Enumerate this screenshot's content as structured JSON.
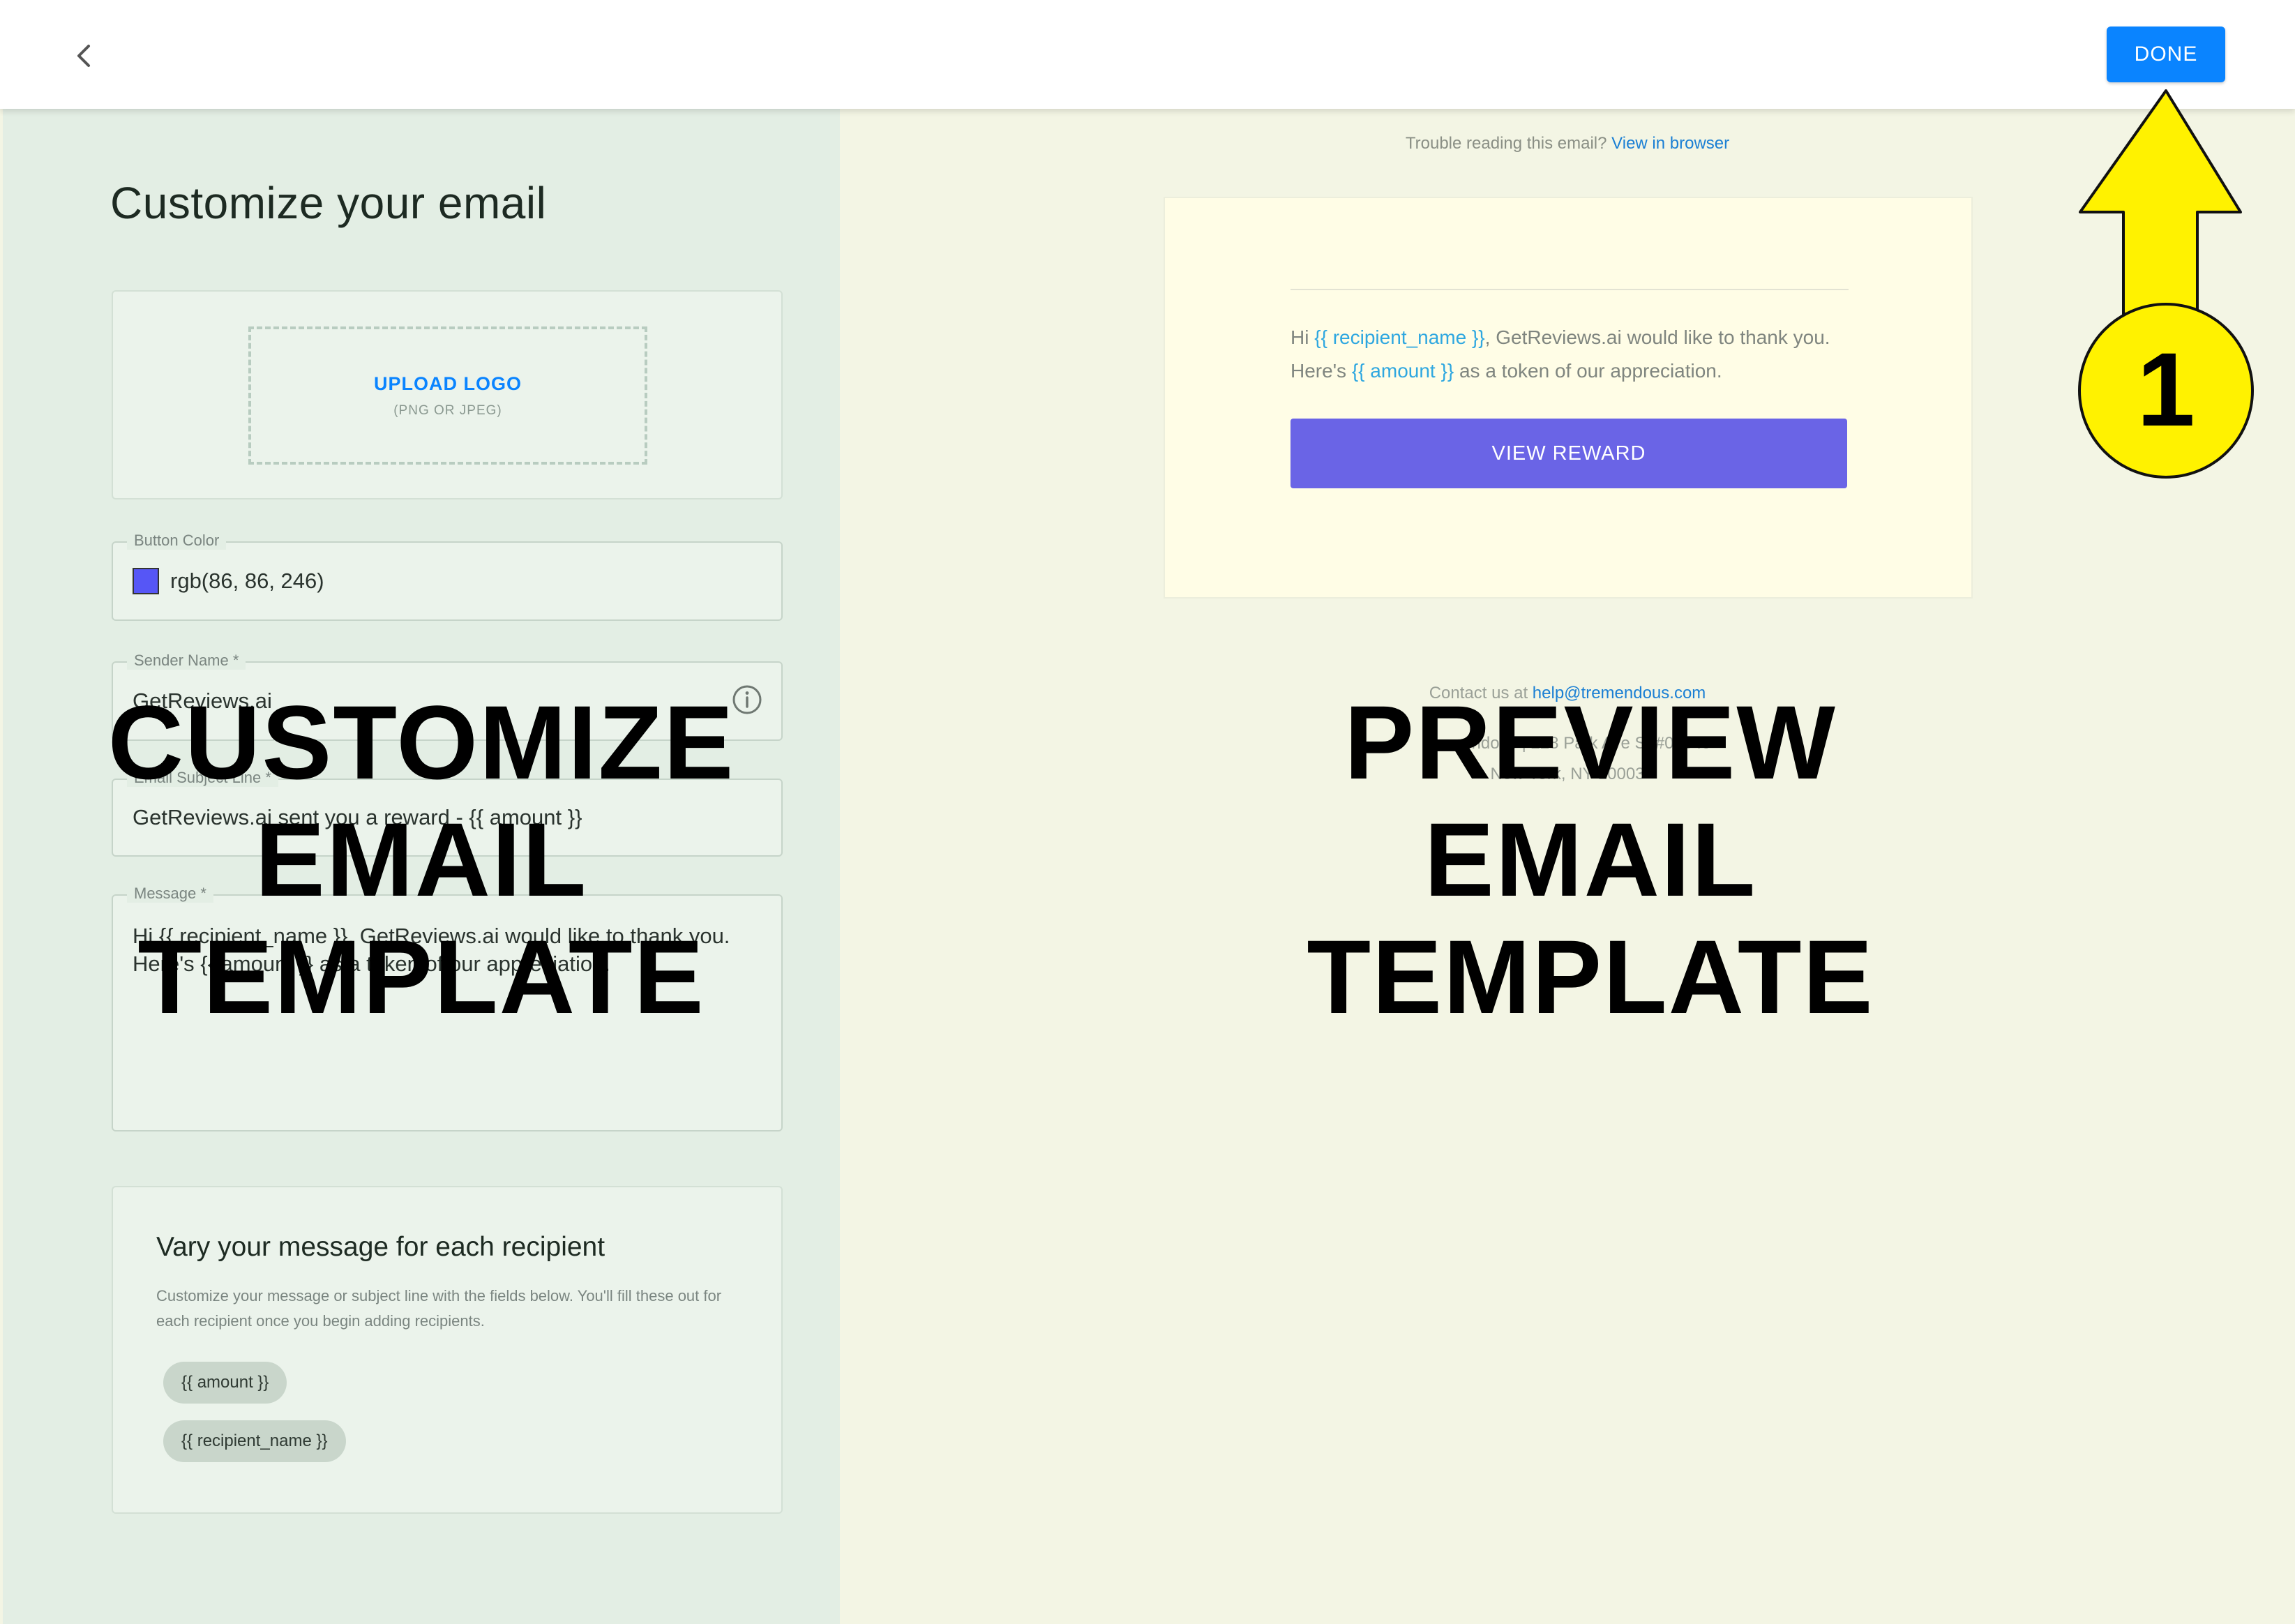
{
  "topbar": {
    "back_icon": "chevron-left-icon",
    "done_label": "DONE"
  },
  "editor": {
    "title": "Customize your email",
    "upload": {
      "title": "UPLOAD LOGO",
      "subtitle": "(PNG OR JPEG)"
    },
    "button_color": {
      "label": "Button Color",
      "value": "rgb(86, 86, 246)",
      "swatch": "#5656f6"
    },
    "sender_name": {
      "label": "Sender Name *",
      "value": "GetReviews.ai",
      "icon": "info-icon"
    },
    "subject": {
      "label": "Email Subject Line *",
      "value": "GetReviews.ai sent you a reward - {{ amount }}"
    },
    "message": {
      "label": "Message *",
      "value": "Hi {{ recipient_name }}, GetReviews.ai would like to thank you. Here's {{ amount }} as a token of our appreciation."
    },
    "vary": {
      "title": "Vary your message for each recipient",
      "description": "Customize your message or subject line with the fields below. You'll fill these out for each recipient once you begin adding recipients.",
      "chips": [
        "{{ amount }}",
        "{{ recipient_name }}"
      ]
    }
  },
  "preview": {
    "trouble_text": "Trouble reading this email?",
    "trouble_link": "View in browser",
    "body_greeting": "Hi ",
    "body_var_name": "{{ recipient_name }}",
    "body_mid": ", GetReviews.ai would like to thank you. Here's ",
    "body_var_amount": "{{ amount }}",
    "body_end": " as a token of our appreciation.",
    "button_label": "VIEW REWARD",
    "button_color": "#6a64e6",
    "contact_text": "Contact us at ",
    "contact_email": "help@tremendous.com",
    "address_line1": "Tremendous | 228 Park Ave S, #02049",
    "address_line2": "New York, NY 10003"
  },
  "overlays": {
    "left": [
      "CUSTOMIZE",
      "EMAIL",
      "TEMPLATE"
    ],
    "right": [
      "PREVIEW",
      "EMAIL",
      "TEMPLATE"
    ],
    "step_number": "1",
    "arrow_color": "#fff200"
  }
}
